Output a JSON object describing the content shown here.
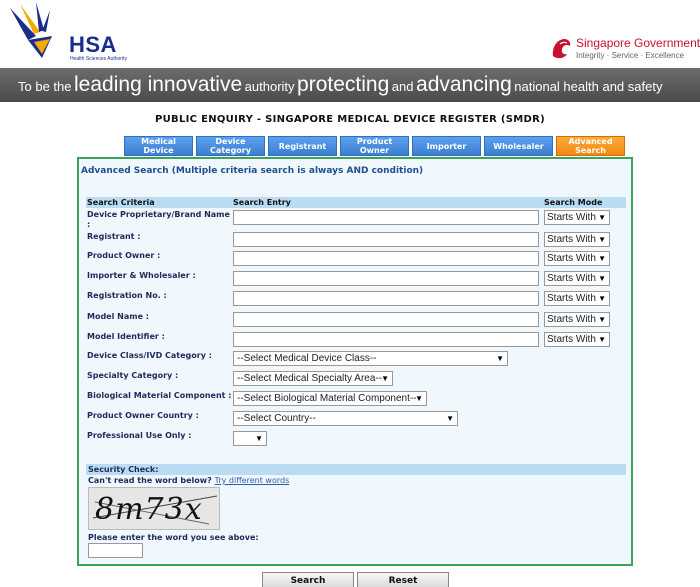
{
  "header": {
    "hsa_logo_text": "HSA",
    "hsa_logo_sub": "Health Sciences Authority",
    "sg_title": "Singapore Government",
    "sg_tagline": "Integrity · Service · Excellence"
  },
  "banner": {
    "parts": [
      "To be the",
      "leading innovative",
      "authority",
      "protecting",
      "and",
      "advancing",
      "national health and safety"
    ]
  },
  "page_title": "PUBLIC ENQUIRY - SINGAPORE MEDICAL DEVICE REGISTER (SMDR)",
  "tabs": [
    {
      "label": "Medical Device"
    },
    {
      "label": "Device Category"
    },
    {
      "label": "Registrant"
    },
    {
      "label": "Product Owner"
    },
    {
      "label": "Importer"
    },
    {
      "label": "Wholesaler"
    },
    {
      "label": "Advanced Search"
    }
  ],
  "panel": {
    "title": "Advanced Search (Multiple criteria search is always AND condition)",
    "headers": {
      "criteria": "Search Criteria",
      "entry": "Search Entry",
      "mode": "Search Mode"
    },
    "fields": [
      {
        "label": "Device Proprietary/Brand Name :",
        "value": "",
        "mode": "Starts With"
      },
      {
        "label": "Registrant :",
        "value": "",
        "mode": "Starts With"
      },
      {
        "label": "Product Owner :",
        "value": "",
        "mode": "Starts With"
      },
      {
        "label": "Importer & Wholesaler :",
        "value": "",
        "mode": "Starts With"
      },
      {
        "label": "Registration No. :",
        "value": "",
        "mode": "Starts With"
      },
      {
        "label": "Model Name :",
        "value": "",
        "mode": "Starts With"
      },
      {
        "label": "Model Identifier :",
        "value": "",
        "mode": "Starts With"
      }
    ],
    "selects": [
      {
        "label": "Device Class/IVD Category :",
        "value": "--Select Medical Device Class--"
      },
      {
        "label": "Specialty Category :",
        "value": "--Select Medical Specialty Area--"
      },
      {
        "label": "Biological Material Component :",
        "value": "--Select Biological Material Component--"
      },
      {
        "label": "Product Owner Country :",
        "value": "--Select Country--"
      },
      {
        "label": "Professional Use Only :",
        "value": ""
      }
    ],
    "security": {
      "label": "Security Check:",
      "cant_read": "Can't read the word below?",
      "try_link": "Try different words",
      "captcha_text": "8m73x",
      "enter_label": "Please enter the word you see above:",
      "enter_value": ""
    }
  },
  "buttons": {
    "search": "Search",
    "reset": "Reset"
  },
  "colors": {
    "tab_blue": "#4a90e2",
    "tab_active_orange": "#f59a1f",
    "panel_border_green": "#3ca35b",
    "header_row_blue": "#b9dcf2",
    "label_navy": "#1e2a5a"
  }
}
